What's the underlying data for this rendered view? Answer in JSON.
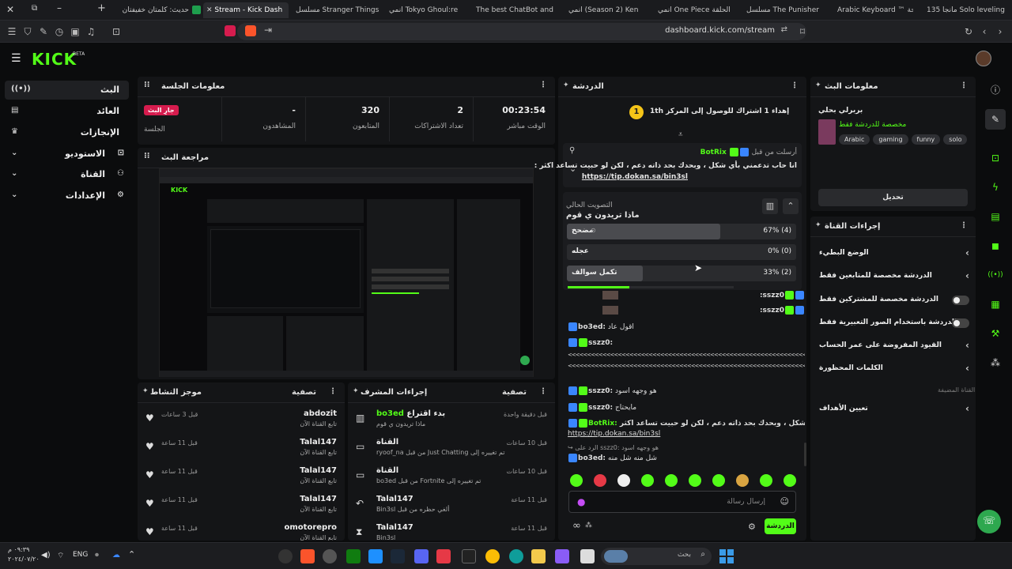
{
  "browser": {
    "tabs": [
      {
        "title": "مانجا 135 Solo leveling"
      },
      {
        "title": "Arabic Keyboard ™ لوحة"
      },
      {
        "title": "مسلسل The Punisher"
      },
      {
        "title": "انمي One Piece الحلقة"
      },
      {
        "title": "انمي (Season 2) Ken"
      },
      {
        "title": "The best ChatBot and"
      },
      {
        "title": "انمي Tokyo Ghoul:re"
      },
      {
        "title": "مسلسل Stranger Things"
      },
      {
        "title": "Stream - Kick Dash"
      },
      {
        "title": "حديث: كلمتان خفيفتان"
      }
    ],
    "url": "dashboard.kick.com/stream"
  },
  "header": {
    "logo": "KICK",
    "beta": "BETA"
  },
  "sidebar": {
    "items": [
      {
        "label": "البث",
        "icon": "broadcast-icon"
      },
      {
        "label": "العائد",
        "icon": "wallet-icon"
      },
      {
        "label": "الإنجازات",
        "icon": "trophy-icon"
      },
      {
        "label": "الاستوديو",
        "icon": "camera-icon"
      },
      {
        "label": "القناة",
        "icon": "users-icon"
      },
      {
        "label": "الإعدادات",
        "icon": "gear-icon"
      }
    ]
  },
  "session": {
    "title": "معلومات الجلسة",
    "live_badge": "جارِ البث",
    "session_label": "الجلسة",
    "stats": [
      {
        "value": "00:23:54",
        "label": "الوقت مباشر"
      },
      {
        "value": "2",
        "label": "تعداد الاشتراكات"
      },
      {
        "value": "320",
        "label": "المتابعون"
      },
      {
        "value": "-",
        "label": "المشاهدون"
      }
    ]
  },
  "preview": {
    "title": "مراجعة البث"
  },
  "activity": {
    "title": "موجز النشاط",
    "filter": "تصفية",
    "rows": [
      {
        "name": "abdozit",
        "sub": "تابع القناة الآن",
        "time": "قبل 3 ساعات"
      },
      {
        "name": "Talal147",
        "sub": "تابع القناة الآن",
        "time": "قبل 11 ساعة"
      },
      {
        "name": "Talal147",
        "sub": "تابع القناة الآن",
        "time": "قبل 11 ساعة"
      },
      {
        "name": "Talal147",
        "sub": "تابع القناة الآن",
        "time": "قبل 11 ساعة"
      },
      {
        "name": "omotorepro",
        "sub": "تابع القناة الآن",
        "time": "قبل 11 ساعة"
      }
    ]
  },
  "modactions": {
    "title": "إجراءات المشرف",
    "filter": "تصفية",
    "rows": [
      {
        "name": "bo3ed",
        "name_suffix": "بدء اقتراع",
        "sub": "ماذا تريدون ي قوم",
        "time": "قبل دقيقة واحدة",
        "icon": "poll-icon"
      },
      {
        "name": "القناة",
        "name_suffix": "",
        "sub": "تم تغييره إلى Just Chatting من قبل ryoof_na",
        "time": "قبل 10 ساعات",
        "icon": "tv-icon"
      },
      {
        "name": "القناة",
        "name_suffix": "",
        "sub": "تم تغييره إلى Fortnite من قبل bo3ed",
        "time": "قبل 10 ساعات",
        "icon": "tv-icon"
      },
      {
        "name": "Talal147",
        "name_suffix": "",
        "sub": "ألغي حظره من قبل Bin3sl",
        "time": "قبل 11 ساعة",
        "icon": "undo-icon"
      },
      {
        "name": "Talal147",
        "name_suffix": "",
        "sub": "Bin3sl",
        "time": "قبل 11 ساعة",
        "icon": "hourglass-icon"
      }
    ]
  },
  "chat": {
    "title": "الدردشة",
    "goal_text": "إهداء 1 اشتراك للوصول إلى المركز 1",
    "goal_suffix": "th",
    "goal_rank": "1",
    "pinned": {
      "sent_by": "أرسلت من قبل",
      "user": "BotRix",
      "text": "انا حاب تدعمني بأي شكل ، وبحدك بحد ذاته دعم ، لكن لو حبيت تساعد اكثر :",
      "link": "https://tip.dokan.sa/bin3sl"
    },
    "poll": {
      "label": "التصويت الحالي",
      "question": "ماذا تريدون ي قوم",
      "options": [
        {
          "label": "مضحخ",
          "pct": "67% (4)",
          "share": 0.67
        },
        {
          "label": "عجله",
          "pct": "0% (0)",
          "share": 0.0
        },
        {
          "label": "تكمل سوالف",
          "pct": "33% (2)",
          "share": 0.33
        }
      ],
      "time_left_fraction": 0.37
    },
    "messages": [
      {
        "user": "sszz0:",
        "text": ""
      },
      {
        "user": "sszz0:",
        "text": ""
      },
      {
        "user": "bo3ed:",
        "text": "اقول عاد"
      },
      {
        "user": "sszz0:",
        "text": ""
      },
      {
        "user": "",
        "text": "<<<<<<<<<<<<<<<<<<<<<<<<<<<<<<<<<<<<<<<<<<<<<<<<<<<<<<<<<<<<<<<<<<<<<<<<^"
      },
      {
        "user": "",
        "text": "<<<<<<<<<<<<<<<<<<<<<<<<<<<<<<<<<<<<<<<<<<<<<<<<<<<<<<<<<<<<<<<<<<<<<<<<^"
      },
      {
        "user": "sszz0:",
        "text": "هو وجهه اسود"
      },
      {
        "user": "sszz0:",
        "text": "مايحتاج"
      },
      {
        "user": "BotRix:",
        "text": "انا حاب تدعمني بأي شكل ، وبحدك بحد ذاته دعم ، لكن لو حبيت تساعد اكثر :"
      },
      {
        "user": "",
        "text": "https://tip.dokan.sa/bin3sl"
      }
    ],
    "reply": {
      "to": "الرد على sszz0: هو وجهه اسود",
      "user": "bo3ed:",
      "text": "شل منه شل منه"
    },
    "input_placeholder": "إرسال رسالة",
    "send_button": "الدردشة"
  },
  "streaminfo": {
    "title": "معلومات البث",
    "stream_title": "بربرلي بحلي",
    "category": "مخصصة للدردشة فقط",
    "tags": [
      "Arabic",
      "gaming",
      "funny",
      "solo"
    ],
    "edit_button": "تحديل"
  },
  "channelactions": {
    "title": "إجراءات القناة",
    "rows": [
      {
        "label": "الوضع البطيء",
        "control": "arrow"
      },
      {
        "label": "الدردشة مخصصة للمتابعين فقط",
        "control": "arrow"
      },
      {
        "label": "الدردشة مخصصة للمشتركين فقط",
        "control": "toggle"
      },
      {
        "label": "الدردشة باستخدام الصور التعبيرية فقط",
        "control": "toggle"
      },
      {
        "label": "القيود المفروضة على عمر الحساب",
        "control": "arrow"
      },
      {
        "label": "الكلمات المحظورة",
        "control": "arrow"
      }
    ],
    "section": "القناة المضيفة",
    "hosting_row": "تعيين الأهداف"
  },
  "taskbar": {
    "time": "٠٩:٣٩ م",
    "date": "٢٠٢٤/٠٧/٢٠",
    "lang": "ENG",
    "search_placeholder": "بحث"
  },
  "colors": {
    "accent": "#53fc18",
    "live": "#d61c4e",
    "panel": "#141517"
  }
}
